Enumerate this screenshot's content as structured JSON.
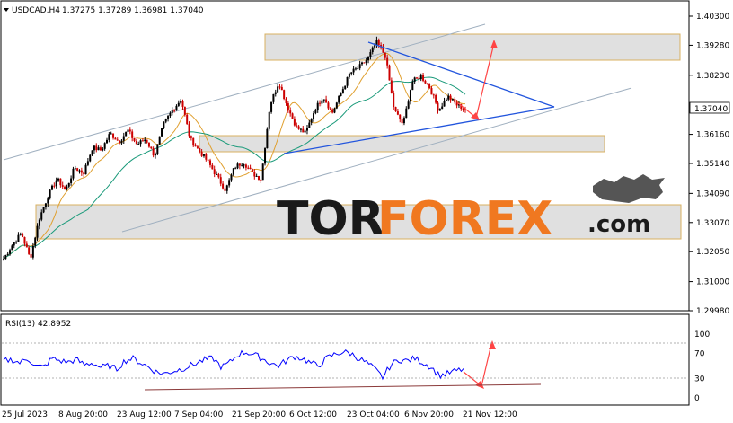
{
  "header": {
    "symbol": "USDCAD,H4",
    "ohlc": "1.37275 1.37289 1.36981 1.37040"
  },
  "price_axis": {
    "ticks": [
      "1.40300",
      "1.39280",
      "1.38230",
      "1.37040",
      "1.36160",
      "1.35140",
      "1.34090",
      "1.33070",
      "1.32050",
      "1.31000",
      "1.29980"
    ],
    "current_price": "1.37040"
  },
  "rsi_panel": {
    "label": "RSI(13) 42.8952",
    "ticks": [
      "100",
      "70",
      "30",
      "0"
    ]
  },
  "time_axis": {
    "labels": [
      "25 Jul 2023",
      "8 Aug 20:00",
      "23 Aug 12:00",
      "7 Sep 04:00",
      "21 Sep 20:00",
      "6 Oct 12:00",
      "23 Oct 04:00",
      "6 Nov 20:00",
      "21 Nov 12:00"
    ]
  },
  "watermark": {
    "part1": "TOR",
    "part2": "FOREX",
    "part3": ".com"
  },
  "colors": {
    "bull_candle": "#000000",
    "bear_candle": "#cc0000",
    "ma_fast": "#e0a030",
    "ma_slow": "#1a9a7a",
    "rsi_line": "#0000ff",
    "trend_blue": "#2255dd",
    "channel": "#a0b0c0",
    "arrow": "#ff4444",
    "zone_fill": "#e0e0e0",
    "zone_border": "#d8b060",
    "watermark_dark": "#1a1a1a",
    "watermark_accent": "#f07820"
  },
  "chart_data": [
    {
      "type": "candlestick",
      "series": [
        {
          "points": [
            [
              0,
              1.318
            ],
            [
              10,
              1.323
            ],
            [
              20,
              1.327
            ],
            [
              30,
              1.318
            ],
            [
              40,
              1.332
            ],
            [
              50,
              1.34
            ],
            [
              60,
              1.346
            ],
            [
              70,
              1.342
            ],
            [
              80,
              1.35
            ],
            [
              90,
              1.348
            ],
            [
              100,
              1.357
            ],
            [
              110,
              1.356
            ],
            [
              120,
              1.362
            ],
            [
              130,
              1.359
            ],
            [
              140,
              1.363
            ],
            [
              150,
              1.358
            ],
            [
              160,
              1.36
            ],
            [
              170,
              1.354
            ],
            [
              180,
              1.365
            ],
            [
              190,
              1.37
            ],
            [
              200,
              1.374
            ],
            [
              210,
              1.36
            ],
            [
              220,
              1.356
            ],
            [
              230,
              1.352
            ],
            [
              240,
              1.347
            ],
            [
              250,
              1.342
            ],
            [
              260,
              1.35
            ],
            [
              270,
              1.352
            ],
            [
              280,
              1.348
            ],
            [
              290,
              1.346
            ],
            [
              300,
              1.372
            ],
            [
              310,
              1.38
            ],
            [
              320,
              1.371
            ],
            [
              330,
              1.364
            ],
            [
              340,
              1.362
            ],
            [
              350,
              1.37
            ],
            [
              360,
              1.375
            ],
            [
              370,
              1.369
            ],
            [
              380,
              1.376
            ],
            [
              390,
              1.383
            ],
            [
              400,
              1.385
            ],
            [
              410,
              1.388
            ],
            [
              420,
              1.394
            ],
            [
              430,
              1.389
            ],
            [
              440,
              1.37
            ],
            [
              450,
              1.365
            ],
            [
              460,
              1.38
            ],
            [
              470,
              1.382
            ],
            [
              480,
              1.378
            ],
            [
              490,
              1.37
            ],
            [
              500,
              1.375
            ],
            [
              510,
              1.372
            ],
            [
              520,
              1.3704
            ]
          ]
        }
      ]
    },
    {
      "type": "line",
      "series": [
        {
          "values": [
            58,
            60,
            55,
            62,
            50,
            48,
            62,
            58,
            56,
            60,
            52,
            55,
            48,
            50,
            45,
            58,
            62,
            55,
            48,
            40,
            38,
            42,
            45,
            50,
            55,
            60,
            62,
            48,
            55,
            68,
            72,
            68,
            62,
            55,
            50,
            58,
            65,
            62,
            55,
            50,
            62,
            68,
            72,
            70,
            62,
            55,
            45,
            32,
            52,
            60,
            58,
            62,
            55,
            48,
            35,
            38,
            42,
            45
          ]
        }
      ]
    }
  ]
}
